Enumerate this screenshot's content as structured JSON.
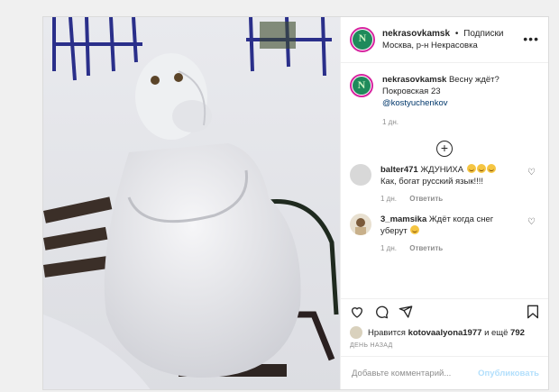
{
  "post": {
    "username": "nekrasovkamsk",
    "separator": "•",
    "follow_label": "Подписки",
    "location": "Москва, р-н Некрасовка",
    "more_icon": "more-horizontal-icon",
    "caption": {
      "username": "nekrasovkamsk",
      "text": "Весну ждёт?",
      "address": "Покровская 23",
      "mention": "@kostyuchenkov",
      "time": "1 дн."
    },
    "load_more_icon": "plus-circle-icon",
    "comments": [
      {
        "username": "balter471",
        "text": "ЖДУНИХА",
        "line2": "Как, богат русский язык!!!!",
        "emoji_count": 3,
        "time": "1 дн.",
        "reply": "Ответить"
      },
      {
        "username": "3_mamsika",
        "text": "Ждёт когда снег",
        "line2": "уберут",
        "emoji_count": 1,
        "time": "1 дн.",
        "reply": "Ответить"
      }
    ],
    "likes": {
      "prefix": "Нравится",
      "user": "kotovaalyona1977",
      "middle": "и ещё",
      "count": "792"
    },
    "date": "ДЕНЬ НАЗАД",
    "comment_placeholder": "Добавьте комментарий...",
    "publish_label": "Опубликовать"
  },
  "colors": {
    "link": "#00376b",
    "muted": "#8e8e8e",
    "publish": "#b2dffc"
  }
}
